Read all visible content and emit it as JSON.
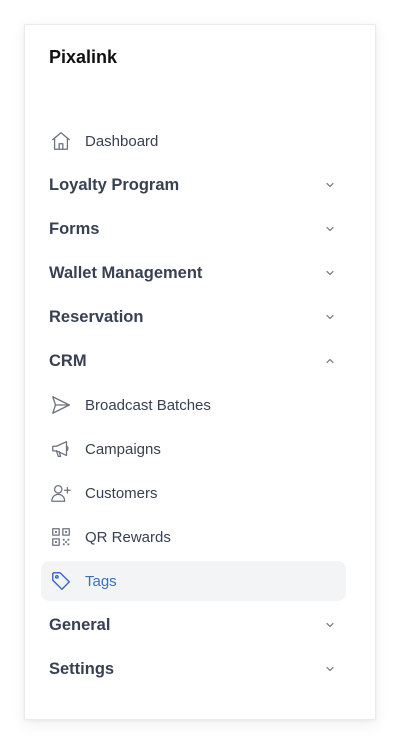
{
  "app": {
    "brand": "Pixalink"
  },
  "nav": {
    "dashboard": {
      "label": "Dashboard",
      "icon": "home-icon"
    },
    "groups": {
      "loyalty": {
        "label": "Loyalty Program",
        "expanded": false
      },
      "forms": {
        "label": "Forms",
        "expanded": false
      },
      "wallet": {
        "label": "Wallet Management",
        "expanded": false
      },
      "reservation": {
        "label": "Reservation",
        "expanded": false
      },
      "crm": {
        "label": "CRM",
        "expanded": true,
        "items": {
          "broadcast": {
            "label": "Broadcast Batches",
            "icon": "send-icon"
          },
          "campaigns": {
            "label": "Campaigns",
            "icon": "megaphone-icon"
          },
          "customers": {
            "label": "Customers",
            "icon": "user-plus-icon"
          },
          "qr_rewards": {
            "label": "QR Rewards",
            "icon": "qr-code-icon"
          },
          "tags": {
            "label": "Tags",
            "icon": "tag-icon",
            "active": true
          }
        }
      },
      "general": {
        "label": "General",
        "expanded": false
      },
      "settings": {
        "label": "Settings",
        "expanded": false
      }
    }
  },
  "colors": {
    "active_text": "#3b6ec4",
    "active_bg": "#f3f4f6",
    "text": "#374151",
    "icon": "#6b7280"
  }
}
